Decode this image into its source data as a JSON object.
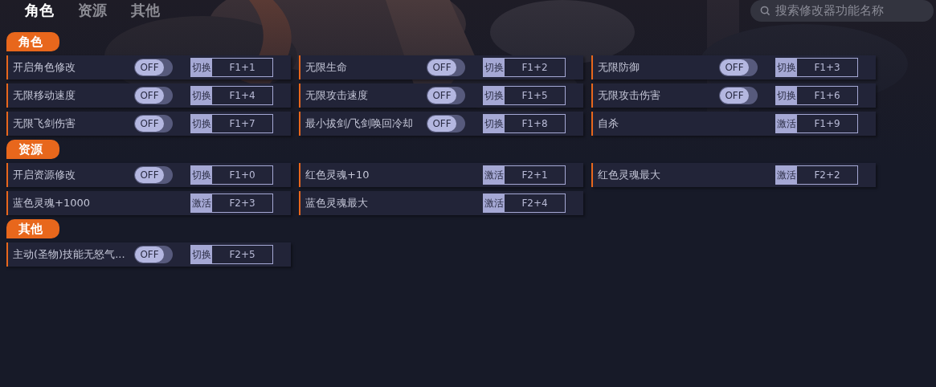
{
  "tabs": [
    {
      "label": "角色",
      "selected": true
    },
    {
      "label": "资源",
      "selected": false
    },
    {
      "label": "其他",
      "selected": false
    }
  ],
  "search": {
    "placeholder": "搜索修改器功能名称"
  },
  "sections": [
    {
      "title": "角色",
      "items": [
        {
          "kind": "toggle",
          "name": "开启角色修改",
          "switch": "OFF",
          "on": false,
          "action": "切换",
          "key": "F1+1"
        },
        {
          "kind": "toggle",
          "name": "无限生命",
          "switch": "OFF",
          "on": false,
          "action": "切换",
          "key": "F1+2"
        },
        {
          "kind": "toggle",
          "name": "无限防御",
          "switch": "OFF",
          "on": false,
          "action": "切换",
          "key": "F1+3"
        },
        {
          "kind": "toggle",
          "name": "无限移动速度",
          "switch": "OFF",
          "on": false,
          "action": "切换",
          "key": "F1+4"
        },
        {
          "kind": "toggle",
          "name": "无限攻击速度",
          "switch": "OFF",
          "on": false,
          "action": "切换",
          "key": "F1+5"
        },
        {
          "kind": "toggle",
          "name": "无限攻击伤害",
          "switch": "OFF",
          "on": false,
          "action": "切换",
          "key": "F1+6"
        },
        {
          "kind": "toggle",
          "name": "无限飞剑伤害",
          "switch": "OFF",
          "on": false,
          "action": "切换",
          "key": "F1+7"
        },
        {
          "kind": "toggle",
          "name": "最小拔剑/飞剑唤回冷却",
          "switch": "OFF",
          "on": false,
          "action": "切换",
          "key": "F1+8"
        },
        {
          "kind": "button",
          "name": "自杀",
          "action": "激活",
          "key": "F1+9"
        }
      ]
    },
    {
      "title": "资源",
      "items": [
        {
          "kind": "toggle",
          "name": "开启资源修改",
          "switch": "OFF",
          "on": false,
          "action": "切换",
          "key": "F1+0"
        },
        {
          "kind": "button",
          "name": "红色灵魂+10",
          "action": "激活",
          "key": "F2+1"
        },
        {
          "kind": "button",
          "name": "红色灵魂最大",
          "action": "激活",
          "key": "F2+2"
        },
        {
          "kind": "button",
          "name": "蓝色灵魂+1000",
          "action": "激活",
          "key": "F2+3"
        },
        {
          "kind": "button",
          "name": "蓝色灵魂最大",
          "action": "激活",
          "key": "F2+4"
        }
      ]
    },
    {
      "title": "其他",
      "items": [
        {
          "kind": "toggle",
          "name": "主动(圣物)技能无怒气...",
          "switch": "OFF",
          "on": false,
          "action": "切换",
          "key": "F2+5"
        }
      ]
    }
  ]
}
